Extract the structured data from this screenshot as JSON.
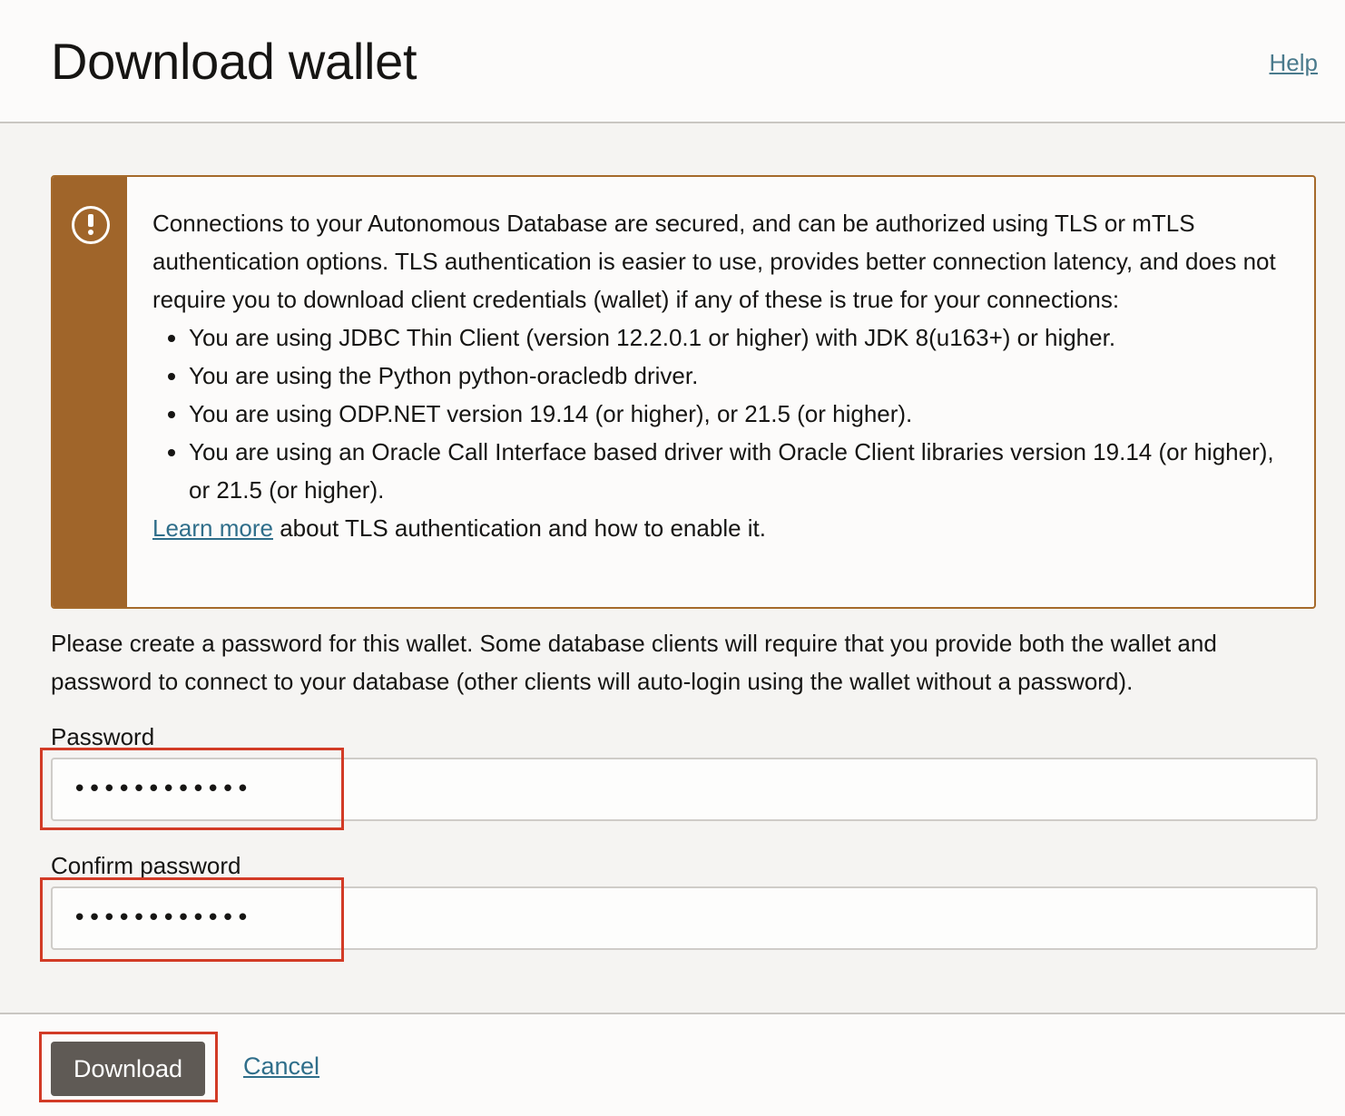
{
  "header": {
    "title": "Download wallet",
    "help_label": "Help"
  },
  "notice": {
    "icon": "exclamation-circle-icon",
    "intro": "Connections to your Autonomous Database are secured, and can be authorized using TLS or mTLS authentication options. TLS authentication is easier to use, provides better connection latency, and does not require you to download client credentials (wallet) if any of these is true for your connections:",
    "items": [
      "You are using JDBC Thin Client (version 12.2.0.1 or higher) with JDK 8(u163+) or higher.",
      "You are using the Python python-oracledb driver.",
      "You are using ODP.NET version 19.14 (or higher), or 21.5 (or higher).",
      "You are using an Oracle Call Interface based driver with Oracle Client libraries version 19.14 (or higher), or 21.5 (or higher)."
    ],
    "learn_more_label": "Learn more",
    "learn_more_suffix": " about TLS authentication and how to enable it."
  },
  "instructions": "Please create a password for this wallet. Some database clients will require that you provide both the wallet and password to connect to your database (other clients will auto-login using the wallet without a password).",
  "password": {
    "label": "Password",
    "value": "••••••••••••"
  },
  "confirm_password": {
    "label": "Confirm password",
    "value": "••••••••••••"
  },
  "footer": {
    "download_label": "Download",
    "cancel_label": "Cancel"
  },
  "colors": {
    "notice_accent": "#a0652a",
    "highlight": "#d23b26",
    "link": "#2f6e8a",
    "primary_button": "#5f5a55"
  }
}
